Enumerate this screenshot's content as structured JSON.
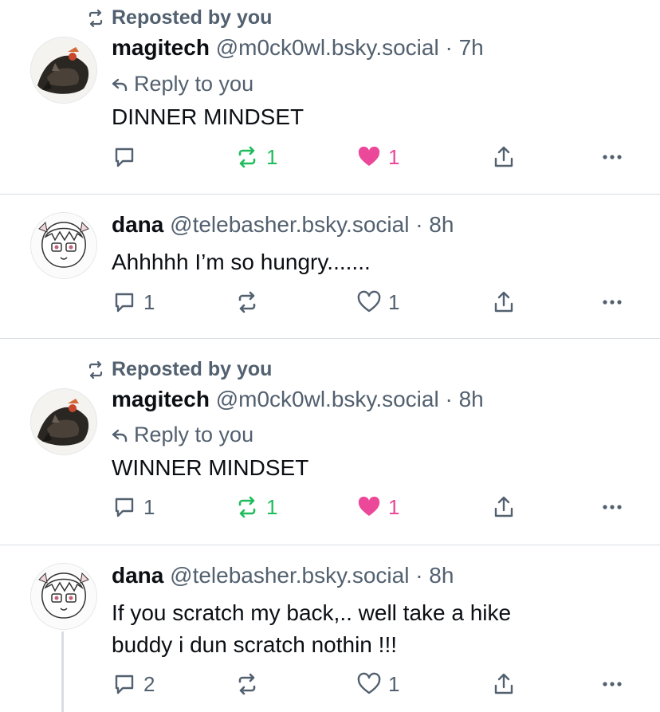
{
  "colors": {
    "muted": "#52606f",
    "text": "#0b0f14",
    "repost_active": "#20bc5c",
    "like_active": "#ec4899",
    "divider": "#d9dee4"
  },
  "posts": [
    {
      "repost_label": "Reposted by you",
      "display_name": "magitech",
      "handle": "@m0ck0wl.bsky.social",
      "time": "· 7h",
      "reply_label": "Reply to you",
      "text": "DINNER MINDSET",
      "reply_count": "",
      "repost_count": "1",
      "like_count": "1"
    },
    {
      "display_name": "dana",
      "handle": "@telebasher.bsky.social",
      "time": "· 8h",
      "text": "Ahhhhh I’m so hungry.......",
      "reply_count": "1",
      "repost_count": "",
      "like_count": "1"
    },
    {
      "repost_label": "Reposted by you",
      "display_name": "magitech",
      "handle": "@m0ck0wl.bsky.social",
      "time": "· 8h",
      "reply_label": "Reply to you",
      "text": "WINNER MINDSET",
      "reply_count": "1",
      "repost_count": "1",
      "like_count": "1"
    },
    {
      "display_name": "dana",
      "handle": "@telebasher.bsky.social",
      "time": "· 8h",
      "text_line1": "If you scratch my back,.. well take a hike",
      "text_line2": "buddy i dun scratch nothin !!!",
      "reply_count": "2",
      "repost_count": "",
      "like_count": "1"
    }
  ]
}
